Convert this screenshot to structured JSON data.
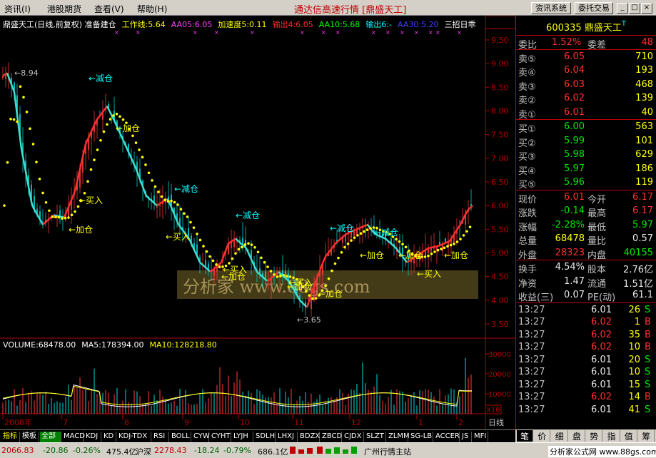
{
  "menu": {
    "items": [
      "资讯(I)",
      "港股期货",
      "查看(V)",
      "帮助(H)"
    ],
    "app_title": "通达信高速行情 [鼎盛天工]",
    "buttons": [
      "资讯系统",
      "委托交易"
    ],
    "win_buttons": [
      "_",
      "□",
      "×"
    ]
  },
  "chart_header": {
    "name": "鼎盛天工(日线,前复权) 准备建仓",
    "fields": [
      {
        "text": "工作线:5.64",
        "color": "#ffff00"
      },
      {
        "text": "AA05:6.05",
        "color": "#ff40ff"
      },
      {
        "text": "加速度5:0.11",
        "color": "#ffff00"
      },
      {
        "text": "输出4:6.05",
        "color": "#ff3030"
      },
      {
        "text": "AA10:5.68",
        "color": "#00ff00"
      },
      {
        "text": "输出6:-",
        "color": "#00ffff"
      },
      {
        "text": "AA30:5.20",
        "color": "#4040ff"
      },
      {
        "text": "三招日乖",
        "color": "#ffffff"
      }
    ]
  },
  "volume_header": [
    {
      "text": "VOLUME:68478.00",
      "color": "#ffffff"
    },
    {
      "text": "MA5:178394.00",
      "color": "#ffffff"
    },
    {
      "text": "MA10:128218.80",
      "color": "#ffff00"
    }
  ],
  "axes": {
    "price_ticks": [
      "9.50",
      "9.00",
      "8.50",
      "8.00",
      "7.50",
      "7.00",
      "6.50",
      "6.00",
      "5.50",
      "5.00",
      "4.50",
      "4.00",
      "3.50"
    ],
    "volume_ticks": [
      "30000",
      "20000",
      "10000"
    ],
    "volume_multiplier": "X10",
    "x_months": [
      "2008年",
      "7",
      "8",
      "9",
      "10",
      "11",
      "12",
      "1",
      "2"
    ],
    "period": "日线"
  },
  "chart_data": {
    "type": "line",
    "annotations": {
      "high_label": "8.94",
      "low_label": "3.65",
      "signals": [
        "减仓",
        "加仓",
        "买入",
        "加仓",
        "减仓",
        "减仓",
        "买入",
        "加仓",
        "买入",
        "加仓",
        "减仓",
        "加仓",
        "买入",
        "加仓",
        "减仓",
        "加仓",
        "买入",
        "加仓"
      ]
    },
    "watermark": "分析家 www.88gs.com"
  },
  "quote": {
    "code": "600335",
    "name": "鼎盛天工",
    "wei_bi": {
      "label": "委比",
      "value": "1.52%",
      "label2": "委差",
      "value2": "48"
    },
    "asks": [
      {
        "label": "卖⑤",
        "price": "6.05",
        "vol": "710"
      },
      {
        "label": "卖④",
        "price": "6.04",
        "vol": "193"
      },
      {
        "label": "卖③",
        "price": "6.03",
        "vol": "468"
      },
      {
        "label": "卖②",
        "price": "6.02",
        "vol": "139"
      },
      {
        "label": "卖①",
        "price": "6.01",
        "vol": "40"
      }
    ],
    "bids": [
      {
        "label": "买①",
        "price": "6.00",
        "vol": "563"
      },
      {
        "label": "买②",
        "price": "5.99",
        "vol": "101"
      },
      {
        "label": "买③",
        "price": "5.98",
        "vol": "629"
      },
      {
        "label": "买④",
        "price": "5.97",
        "vol": "186"
      },
      {
        "label": "买⑤",
        "price": "5.96",
        "vol": "119"
      }
    ],
    "stats": [
      {
        "l1": "现价",
        "v1": "6.01",
        "c1": "#ff3030",
        "l2": "今开",
        "v2": "6.17",
        "c2": "#ff3030"
      },
      {
        "l1": "涨跌",
        "v1": "-0.14",
        "c1": "#00e600",
        "l2": "最高",
        "v2": "6.17",
        "c2": "#ff3030"
      },
      {
        "l1": "涨幅",
        "v1": "-2.28%",
        "c1": "#00e600",
        "l2": "最低",
        "v2": "5.97",
        "c2": "#00e600"
      },
      {
        "l1": "总量",
        "v1": "68478",
        "c1": "#ffff00",
        "l2": "量比",
        "v2": "0.57",
        "c2": "#e8e8e8"
      },
      {
        "l1": "外盘",
        "v1": "28323",
        "c1": "#ff3030",
        "l2": "内盘",
        "v2": "40155",
        "c2": "#00e600"
      }
    ],
    "stats2": [
      {
        "l1": "换手",
        "v1": "4.54%",
        "l2": "股本",
        "v2": "2.76亿"
      },
      {
        "l1": "净资",
        "v1": "1.47",
        "l2": "流通",
        "v2": "1.51亿"
      },
      {
        "l1": "收益(三)",
        "v1": "0.07",
        "l2": "PE(动)",
        "v2": "61.1"
      }
    ],
    "ticks": [
      {
        "time": "13:27",
        "price": "6.01",
        "vol": "26",
        "side": "S"
      },
      {
        "time": "13:27",
        "price": "6.02",
        "vol": "1",
        "side": "B"
      },
      {
        "time": "13:27",
        "price": "6.02",
        "vol": "35",
        "side": "B"
      },
      {
        "time": "13:27",
        "price": "6.02",
        "vol": "10",
        "side": "B"
      },
      {
        "time": "13:27",
        "price": "6.01",
        "vol": "20",
        "side": "S"
      },
      {
        "time": "13:27",
        "price": "6.01",
        "vol": "10",
        "side": "S"
      },
      {
        "time": "13:27",
        "price": "6.01",
        "vol": "15",
        "side": "S"
      },
      {
        "time": "13:27",
        "price": "6.02",
        "vol": "14",
        "side": "B"
      },
      {
        "time": "13:27",
        "price": "6.01",
        "vol": "41",
        "side": "S"
      }
    ]
  },
  "tabs": [
    "指标",
    "模板",
    "全部",
    "MACD",
    "KDJ",
    "KD",
    "KDJ-TDX",
    "RSI",
    "BOLL",
    "CYW",
    "CYHT",
    "LYJH",
    "SDLH",
    "LHXJ",
    "BDZX",
    "ZBCD",
    "CJDX",
    "SLZT",
    "ZLMM",
    "SG-LB",
    "ACCER",
    "JS",
    "MFI"
  ],
  "right_tabs": [
    "笔",
    "价",
    "细",
    "盘",
    "势",
    "指",
    "值",
    "筹"
  ],
  "status": {
    "sh_index": "2066.83",
    "sh_change": "-20.86",
    "sh_pct": "-0.26%",
    "sh_amount": "475.4亿",
    "sz_label": "沪深",
    "sz_index": "2278.43",
    "sz_change": "-18.24",
    "sz_pct": "-0.79%",
    "sz_amount": "686.1亿",
    "station": "广州行情主站",
    "brand": "分析家公式网 www.88gs.com"
  }
}
